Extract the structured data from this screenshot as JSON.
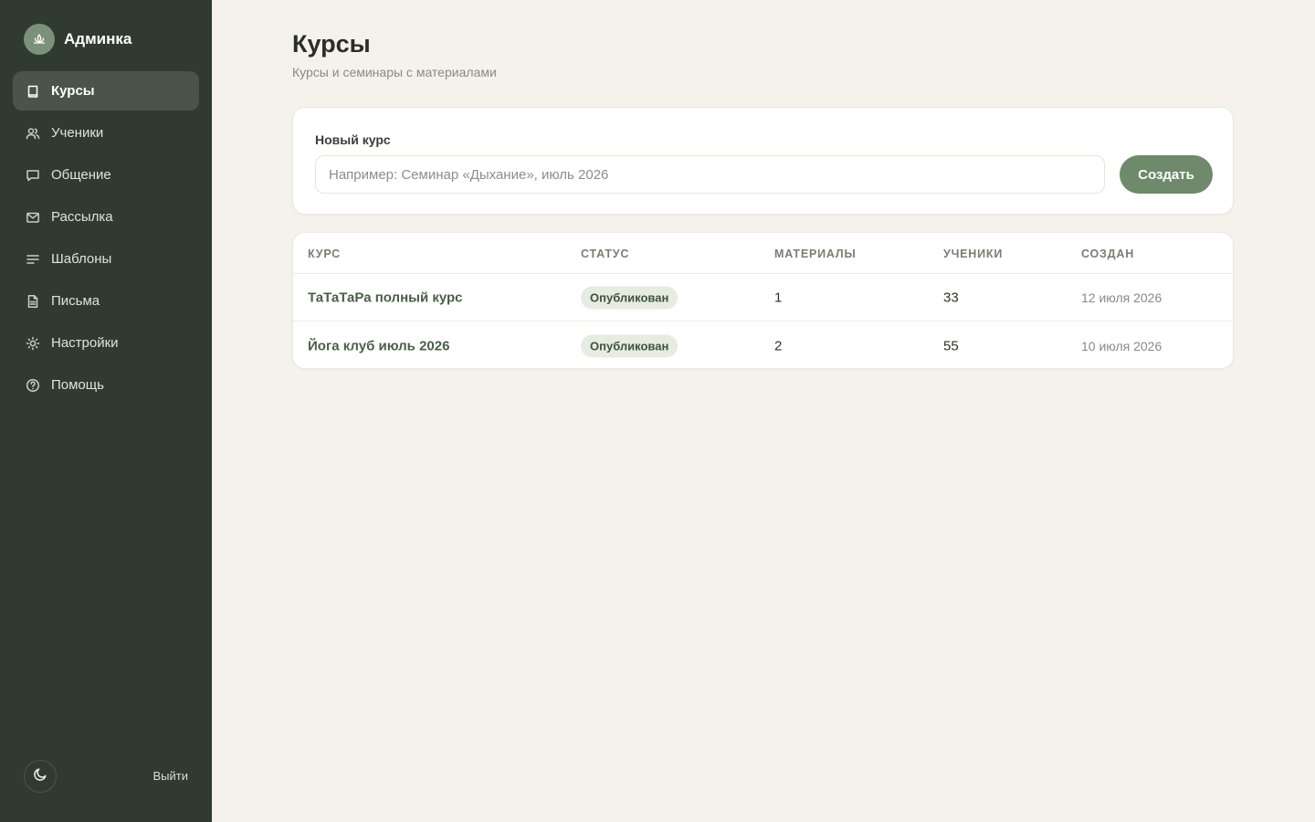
{
  "app": {
    "title": "Админка"
  },
  "sidebar": {
    "items": [
      {
        "label": "Курсы",
        "icon": "book-icon",
        "active": true
      },
      {
        "label": "Ученики",
        "icon": "users-icon",
        "active": false
      },
      {
        "label": "Общение",
        "icon": "chat-icon",
        "active": false
      },
      {
        "label": "Рассылка",
        "icon": "mail-icon",
        "active": false
      },
      {
        "label": "Шаблоны",
        "icon": "lines-icon",
        "active": false
      },
      {
        "label": "Письма",
        "icon": "document-icon",
        "active": false
      },
      {
        "label": "Настройки",
        "icon": "sun-icon",
        "active": false
      },
      {
        "label": "Помощь",
        "icon": "help-icon",
        "active": false
      }
    ],
    "footer": {
      "theme_icon": "moon-icon",
      "logout_label": "Выйти"
    }
  },
  "page": {
    "title": "Курсы",
    "subtitle": "Курсы и семинары с материалами"
  },
  "new_course": {
    "label": "Новый курс",
    "value": "",
    "placeholder": "Например: Семинар «Дыхание», июль 2026",
    "button_label": "Создать"
  },
  "table": {
    "columns": [
      "КУРС",
      "СТАТУС",
      "МАТЕРИАЛЫ",
      "УЧЕНИКИ",
      "СОЗДАН"
    ],
    "rows": [
      {
        "course": "ТаТаТаРа полный курс",
        "status": "Опубликован",
        "materials": "1",
        "students": "33",
        "created": "12 июля 2026"
      },
      {
        "course": "Йога клуб июль 2026",
        "status": "Опубликован",
        "materials": "2",
        "students": "55",
        "created": "10 июля 2026"
      }
    ]
  },
  "colors": {
    "sidebar_bg": "#303a30",
    "accent": "#6e8a6b",
    "page_bg": "#f5f2ec",
    "badge_bg": "#e7ece2"
  }
}
